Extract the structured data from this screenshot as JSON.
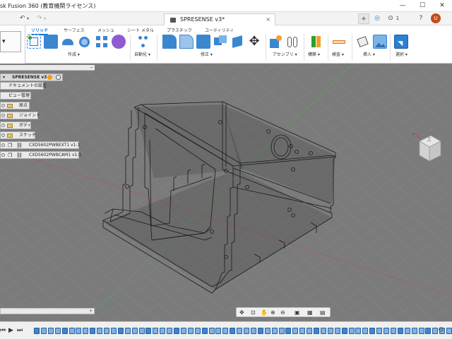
{
  "window": {
    "title": "sk Fusion 360 (教育機関ライセンス)",
    "minimize": "—",
    "maximize": "☐",
    "close": "✕"
  },
  "quick_access": {
    "undo": "↶",
    "undo_dd": "▾",
    "redo": "↷",
    "redo_dd": "▾"
  },
  "document_tab": {
    "name": "SPRESENSE v3*",
    "close": "×"
  },
  "right_quick": {
    "add": "+",
    "online": "◎",
    "jobs": "⊙",
    "jobs_count": "1",
    "help": "?",
    "user": "U"
  },
  "ribbon": {
    "tabs": [
      "ソリッド",
      "サーフェス",
      "メッシュ",
      "シート メタル",
      "プラスチック",
      "ユーティリティ"
    ],
    "active_tab": "ソリッド",
    "groups": {
      "create": "作成 ▾",
      "automate": "自動化 ▾",
      "modify": "修正 ▾",
      "assemble": "アセンブリ ▾",
      "construct": "構築 ▾",
      "inspect": "検査 ▾",
      "insert": "挿入 ▾",
      "select": "選択 ▾"
    }
  },
  "browser": {
    "collapse": "<<",
    "expand": "−",
    "root": "SPRESENSE v3",
    "items": [
      {
        "label": "ドキュメントの設定"
      },
      {
        "label": "ビュー管理"
      },
      {
        "label": "原点"
      },
      {
        "label": "ジョイント"
      },
      {
        "label": "ボディ"
      },
      {
        "label": "スケッチ"
      },
      {
        "label": "CXD5602PWBEXT1 v1:1"
      },
      {
        "label": "CXD5602PWBCAM1 v1:1"
      }
    ]
  },
  "comments": {
    "collapse": "<<",
    "expand": "+"
  },
  "viewcube": {
    "face": "上"
  },
  "nav_bar": {
    "orbit": "✥",
    "pan_look": "⊡",
    "pan": "✋",
    "zoom": "⊕",
    "zoom_window": "⊖",
    "display": "▣",
    "grid": "▦",
    "viewports": "▤"
  },
  "timeline": {
    "rewind": "⏮",
    "prev": "◀",
    "play": "▶",
    "next": "▶",
    "end": "⏭",
    "settings": "⚙"
  },
  "colors": {
    "accent": "#0a6fd1",
    "viewport_bg": "#7b7b7b",
    "folder": "#e3c46e",
    "timeline_sketch": "#7bb3e6",
    "timeline_feature": "#3b86d1"
  }
}
